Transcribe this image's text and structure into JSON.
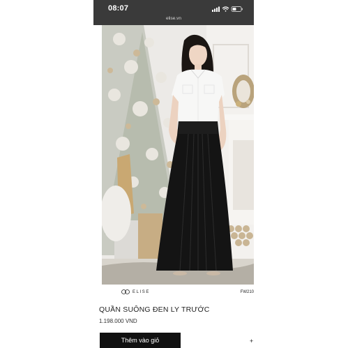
{
  "status_bar": {
    "time": "08:07",
    "url": "elise.vn",
    "icons": [
      "signal-icon",
      "wifi-icon",
      "battery-icon"
    ]
  },
  "product": {
    "image": "product-photo",
    "brand": "ELISE",
    "sku": "FW210",
    "title": "QUẦN SUÔNG ĐEN LY TRƯỚC",
    "price": "1.198.000 VND",
    "add_to_cart_label": "Thêm vào giỏ",
    "quantity_plus": "+"
  },
  "colors": {
    "status_bar_bg": "#3a3a3a",
    "button_bg": "#111111",
    "text": "#222222"
  }
}
